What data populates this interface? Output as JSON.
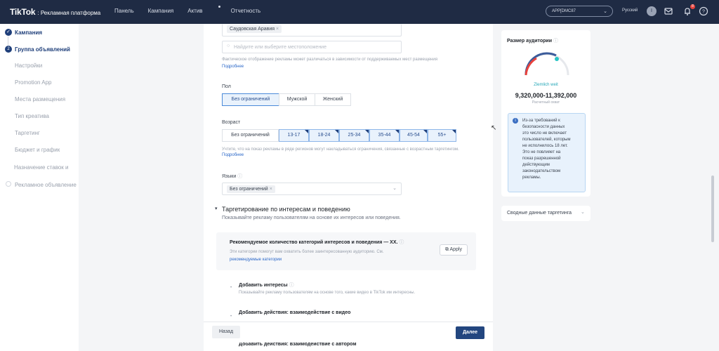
{
  "header": {
    "brand": "TikTok",
    "brand_sub": ": Рекламная платформа",
    "nav": [
      "Панель",
      "Кампания",
      "Актив",
      "Отчетность"
    ],
    "account": "APP[DMC87",
    "language": "Русский",
    "avatar_letter": "I",
    "notif_count": "8"
  },
  "sidebar": {
    "items": [
      {
        "label": "Кампания",
        "state": "done"
      },
      {
        "label": "Группа объявлений",
        "state": "current",
        "num": "2"
      },
      {
        "label": "Настройки"
      },
      {
        "label": "Promotion App"
      },
      {
        "label": "Места размещения"
      },
      {
        "label": "Тип креатива"
      },
      {
        "label": "Таргетинг"
      },
      {
        "label": "Бюджет и график"
      },
      {
        "label": "Назначение ставок и"
      },
      {
        "label": "Рекламное объявление"
      }
    ]
  },
  "location": {
    "selected_tag": "Саудовская Аравия",
    "search_placeholder": "Найдите или выберите местоположение",
    "note": "Фактическое отображение рекламы может различаться в зависимости от поддерживаемых мест размещения",
    "more_link": "Подробнее"
  },
  "gender": {
    "label": "Пол",
    "options": [
      "Без ограничений",
      "Мужской",
      "Женский"
    ]
  },
  "age": {
    "label": "Возраст",
    "options": [
      "Без ограничений",
      "13-17",
      "18-24",
      "25-34",
      "35-44",
      "45-54",
      "55+"
    ],
    "note": "Учтите, что на показ рекламы в ряде регионов могут накладываться ограничения, связанные с возрастным таргетингом.",
    "more_link": "Подробнее"
  },
  "languages": {
    "label": "Языки",
    "tag": "Без ограничений"
  },
  "interests": {
    "title": "Таргетирование по интересам и поведению",
    "subtitle": "Показывайте рекламу пользователям на основе их интересов или поведения.",
    "rec_title": "Рекомендуемое количество категорий интересов и поведения — XX.",
    "rec_text": "Эти категории помогут вам охватить более заинтересованную аудиторию. См.",
    "rec_link": "рекомендуемые категории",
    "apply": "Apply",
    "add_interests": "Добавить интересы",
    "add_interests_desc": "Показывайте рекламу пользователям на основе того, какие видео в TikTok им интересны.",
    "add_actions": "Добавить действия: взаимодействие с видео",
    "add_actions_2": "Добавить действия: взаимодействие с автором"
  },
  "footer": {
    "back": "Назад",
    "next": "Далее"
  },
  "audience": {
    "title": "Размер аудитории",
    "status": "Zlemlich weit",
    "range": "9,320,000-11,392,000",
    "sub": "Расчетный охват",
    "info": "Из-за требований к безопасности данных это число не включает пользователей, которым не исполнилось 18 лет. Это не повлияет на показ разрешенной действующим законодательством рекламы."
  },
  "targeting_summary": "Сводные данные таргетинга"
}
